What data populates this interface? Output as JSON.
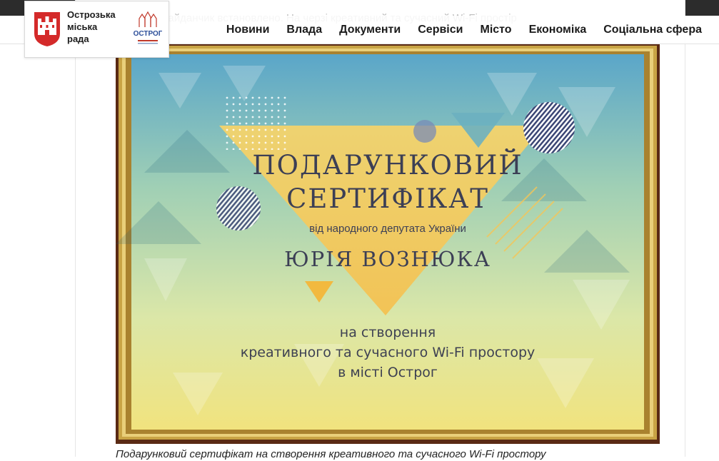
{
  "header": {
    "city_name_lines": [
      "Острозька",
      "міська",
      "рада"
    ],
    "logo_text": "ОСТРОГ"
  },
  "nav": [
    {
      "label": "Новини"
    },
    {
      "label": "Влада"
    },
    {
      "label": "Документи"
    },
    {
      "label": "Сервіси"
    },
    {
      "label": "Місто"
    },
    {
      "label": "Економіка"
    },
    {
      "label": "Соціальна сфера"
    }
  ],
  "article": {
    "text_behind_header": "ний дитячий майданчик встановлено. На черзі креативний та сучасний Wi-Fi простір"
  },
  "certificate": {
    "title_line1": "ПОДАРУНКОВИЙ",
    "title_line2": "СЕРТИФІКАТ",
    "subtitle": "від народного депутата України",
    "name": "ЮРІЯ ВОЗНЮКА",
    "purpose_line1": "на створення",
    "purpose_line2": "креативного та сучасного Wi-Fi простору",
    "purpose_line3": "в місті Острог"
  },
  "caption": "Подарунковий сертифікат на створення креативного та сучасного Wi-Fi простору",
  "colors": {
    "topbar": "#2c2c2c",
    "frame_gold": "#b8923a",
    "frame_wood": "#5a2a14",
    "nav_text": "#1b1b1b",
    "cert_text": "#3c3f55",
    "coat_red": "#d42a2a"
  }
}
